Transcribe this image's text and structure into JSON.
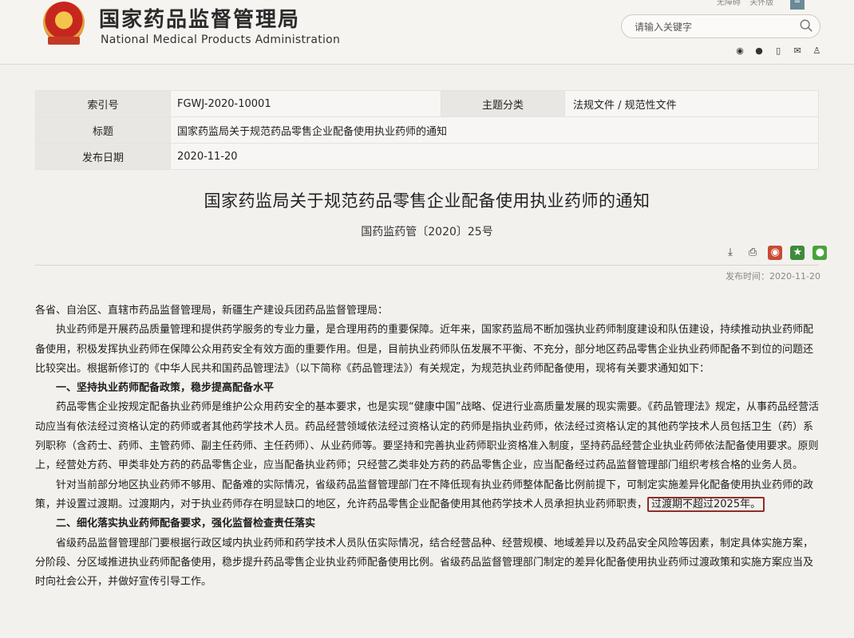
{
  "header": {
    "site_title": "国家药品监督管理局",
    "site_subtitle": "National Medical Products Administration",
    "top_links": [
      "无障碍",
      "关怀版"
    ],
    "search_placeholder": "请输入关键字"
  },
  "meta": {
    "index_label": "索引号",
    "index_value": "FGWJ-2020-10001",
    "category_label": "主题分类",
    "category_value": "法规文件 / 规范性文件",
    "title_label": "标题",
    "title_value": "国家药监局关于规范药品零售企业配备使用执业药师的通知",
    "date_label": "发布日期",
    "date_value": "2020-11-20"
  },
  "document": {
    "title": "国家药监局关于规范药品零售企业配备使用执业药师的通知",
    "doc_number": "国药监药管〔2020〕25号",
    "publish_time": "发布时间：2020-11-20",
    "addressee": "各省、自治区、直辖市药品监督管理局，新疆生产建设兵团药品监督管理局：",
    "intro": "执业药师是开展药品质量管理和提供药学服务的专业力量，是合理用药的重要保障。近年来，国家药监局不断加强执业药师制度建设和队伍建设，持续推动执业药师配备使用，积极发挥执业药师在保障公众用药安全有效方面的重要作用。但是，目前执业药师队伍发展不平衡、不充分，部分地区药品零售企业执业药师配备不到位的问题还比较突出。根据新修订的《中华人民共和国药品管理法》（以下简称《药品管理法》）有关规定，为规范执业药师配备使用，现将有关要求通知如下：",
    "section1_heading": "一、坚持执业药师配备政策，稳步提高配备水平",
    "section1_p1": "药品零售企业按规定配备执业药师是维护公众用药安全的基本要求，也是实现“健康中国”战略、促进行业高质量发展的现实需要。《药品管理法》规定，从事药品经营活动应当有依法经过资格认定的药师或者其他药学技术人员。药品经营领域依法经过资格认定的药师是指执业药师，依法经过资格认定的其他药学技术人员包括卫生（药）系列职称（含药士、药师、主管药师、副主任药师、主任药师）、从业药师等。要坚持和完善执业药师职业资格准入制度，坚持药品经营企业执业药师依法配备使用要求。原则上，经营处方药、甲类非处方药的药品零售企业，应当配备执业药师；只经营乙类非处方药的药品零售企业，应当配备经过药品监督管理部门组织考核合格的业务人员。",
    "section1_p2_main": "针对当前部分地区执业药师不够用、配备难的实际情况，省级药品监督管理部门在不降低现有执业药师整体配备比例前提下，可制定实施差异化配备使用执业药师的政策，并设置过渡期。过渡期内，对于执业药师存在明显缺口的地区，允许药品零售企业配备使用其他药学技术人员承担执业药师职责，",
    "section1_p2_highlight": "过渡期不超过2025年。",
    "section2_heading": "二、细化落实执业药师配备要求，强化监督检查责任落实",
    "section2_p1": "省级药品监督管理部门要根据行政区域内执业药师和药学技术人员队伍实际情况，结合经营品种、经营规模、地域差异以及药品安全风险等因素，制定具体实施方案，分阶段、分区域推进执业药师配备使用，稳步提升药品零售企业执业药师配备使用比例。省级药品监督管理部门制定的差异化配备使用执业药师过渡政策和实施方案应当及时向社会公开，并做好宣传引导工作。"
  }
}
